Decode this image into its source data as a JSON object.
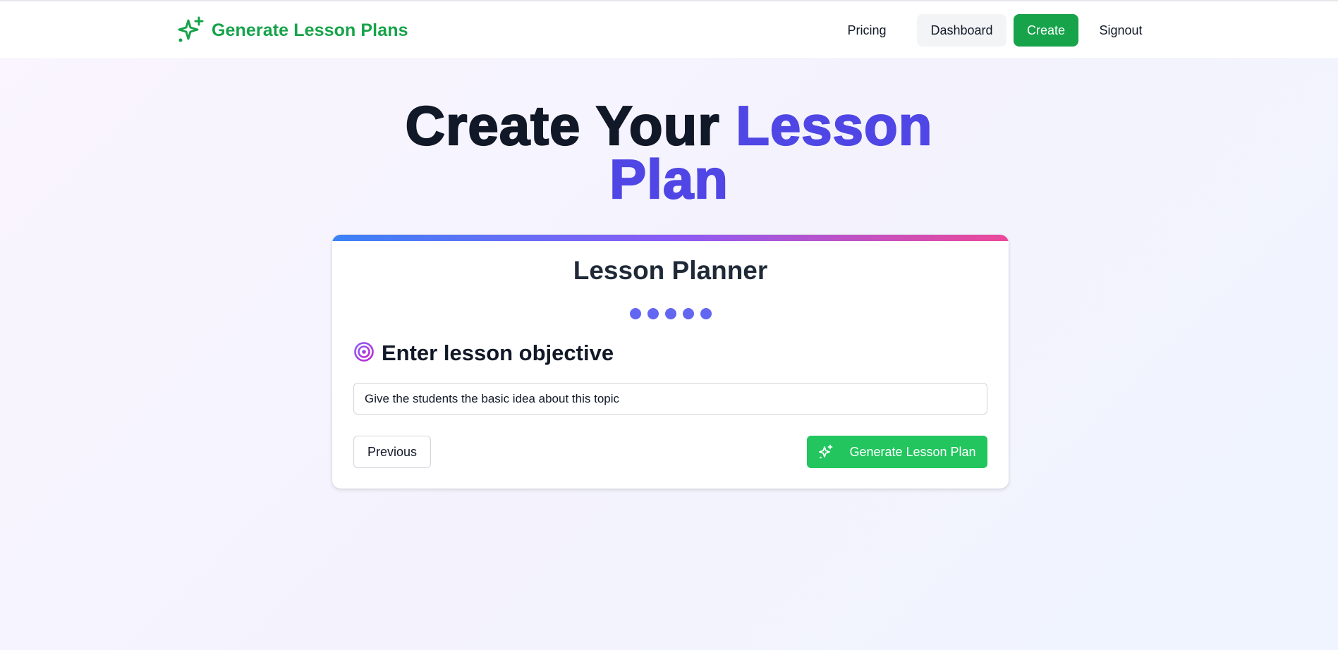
{
  "brand": {
    "name": "Generate Lesson Plans",
    "icon": "sparkles-icon",
    "color": "#16a34a"
  },
  "nav": {
    "pricing": "Pricing",
    "dashboard": "Dashboard",
    "create": "Create",
    "signout": "Signout"
  },
  "hero": {
    "line1_plain": "Create Your ",
    "line1_accent": "Lesson",
    "line2_accent": "Plan",
    "accent_color": "#4f46e5"
  },
  "planner": {
    "title": "Lesson Planner",
    "steps_total": 5,
    "step_icon": "target-icon",
    "step_label": "Enter lesson objective",
    "objective_value": "Give the students the basic idea about this topic",
    "previous_label": "Previous",
    "generate_label": "Generate Lesson Plan",
    "generate_icon": "sparkles-icon"
  },
  "colors": {
    "primary_green": "#16a34a",
    "generate_green": "#22c55e",
    "step_dot": "#6366f1",
    "gradient": [
      "#3b82f6",
      "#8b5cf6",
      "#ec4899"
    ]
  }
}
